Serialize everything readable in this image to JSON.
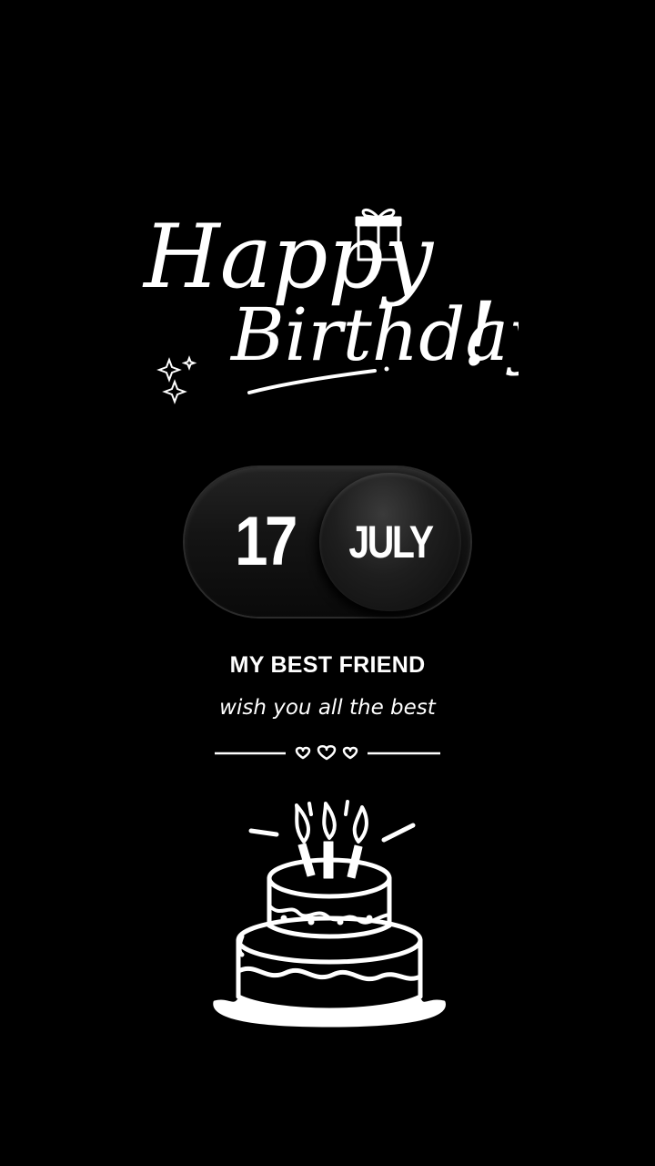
{
  "greeting": {
    "line1": "Happy",
    "line2": "Birthday",
    "exclamation": "!"
  },
  "icons": {
    "gift": "gift-box-icon",
    "sparkles": "sparkles-icon",
    "hearts": "hearts-icon",
    "cake": "birthday-cake-icon"
  },
  "date": {
    "day": "17",
    "month": "JULY"
  },
  "heading": "MY BEST FRIEND",
  "subtitle": "wish you all the best",
  "colors": {
    "background": "#000000",
    "foreground": "#ffffff",
    "pill": "#141414"
  }
}
